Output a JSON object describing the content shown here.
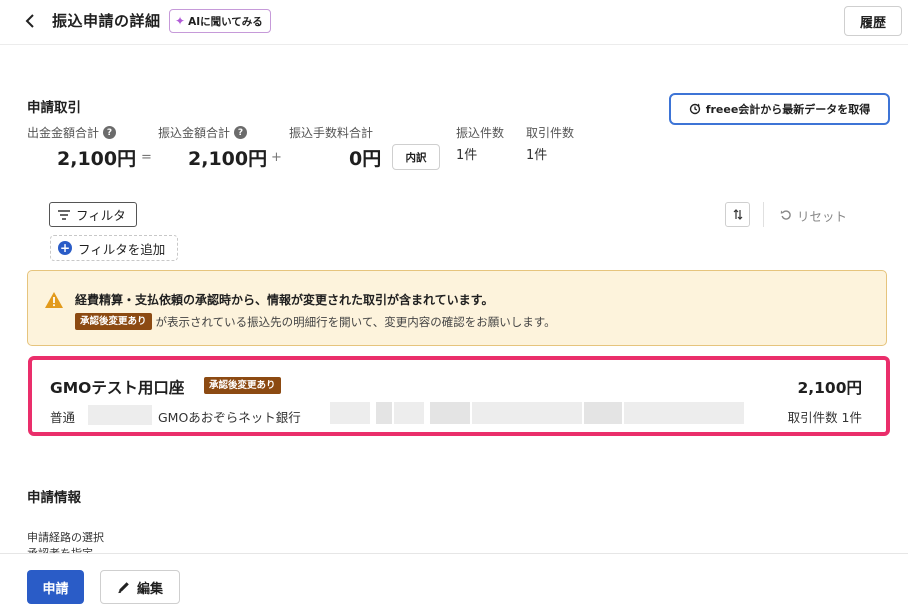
{
  "header": {
    "title": "振込申請の詳細",
    "ai_button_label": "AIに聞いてみる",
    "history_button_label": "履歴"
  },
  "summary": {
    "section_title": "申請取引",
    "fetch_button_label": "freee会計から最新データを取得",
    "outgoing_total_label": "出金金額合計",
    "outgoing_total_value": "2,100円",
    "equals_sign": "=",
    "transfer_total_label": "振込金額合計",
    "transfer_total_value": "2,100円",
    "plus_sign": "+",
    "fee_total_label": "振込手数料合計",
    "fee_total_value": "0円",
    "breakdown_button_label": "内訳",
    "transfer_count_label": "振込件数",
    "transfer_count_value": "1件",
    "transaction_count_label": "取引件数",
    "transaction_count_value": "1件"
  },
  "filters": {
    "filter_button_label": "フィルタ",
    "add_filter_label": "フィルタを追加",
    "reset_label": "リセット"
  },
  "warning": {
    "title": "経費精算・支払依頼の承認時から、情報が変更された取引が含まれています。",
    "badge": "承認後変更あり",
    "body": "が表示されている振込先の明細行を開いて、変更内容の確認をお願いします。"
  },
  "account": {
    "name": "GMOテスト用口座",
    "badge": "承認後変更あり",
    "amount": "2,100円",
    "account_type": "普通",
    "bank_name": "GMOあおぞらネット銀行",
    "transaction_count": "取引件数 1件"
  },
  "info": {
    "section_title": "申請情報",
    "route_label": "申請経路の選択",
    "route_cut_text": "承認者を指定"
  },
  "footer": {
    "apply_button_label": "申請",
    "edit_button_label": "編集"
  },
  "colors": {
    "primary": "#2a5cc7",
    "highlight_border": "#ea2e6b",
    "badge_bg": "#8c4a12",
    "warning_bg": "#fdf3dc"
  }
}
